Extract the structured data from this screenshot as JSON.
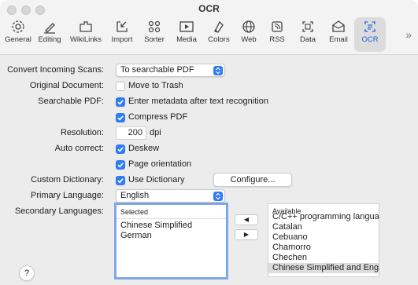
{
  "window": {
    "title": "OCR"
  },
  "toolbar": {
    "items": [
      {
        "label": "General",
        "icon": "gear-icon"
      },
      {
        "label": "Editing",
        "icon": "pen-icon"
      },
      {
        "label": "WikiLinks",
        "icon": "puzzle-icon"
      },
      {
        "label": "Import",
        "icon": "import-icon"
      },
      {
        "label": "Sorter",
        "icon": "sorter-icon"
      },
      {
        "label": "Media",
        "icon": "media-icon"
      },
      {
        "label": "Colors",
        "icon": "colors-icon"
      },
      {
        "label": "Web",
        "icon": "globe-icon"
      },
      {
        "label": "RSS",
        "icon": "rss-icon"
      },
      {
        "label": "Data",
        "icon": "data-icon"
      },
      {
        "label": "Email",
        "icon": "email-icon"
      },
      {
        "label": "OCR",
        "icon": "ocr-icon",
        "active": true
      }
    ],
    "overflow": "»",
    "accent": "#2f7cf6"
  },
  "form": {
    "convert_label": "Convert Incoming Scans:",
    "convert_value": "To searchable PDF",
    "original_label": "Original Document:",
    "move_to_trash": "Move to Trash",
    "searchable_label": "Searchable PDF:",
    "enter_metadata": "Enter metadata after text recognition",
    "compress_pdf": "Compress PDF",
    "resolution_label": "Resolution:",
    "resolution_value": "200",
    "resolution_unit": "dpi",
    "autocorrect_label": "Auto correct:",
    "deskew": "Deskew",
    "page_orientation": "Page orientation",
    "custom_dict_label": "Custom Dictionary:",
    "use_dictionary": "Use Dictionary",
    "configure_button": "Configure...",
    "primary_label": "Primary Language:",
    "primary_value": "English",
    "secondary_label": "Secondary Languages:"
  },
  "selected_list": {
    "header": "Selected",
    "items": [
      "Chinese Simplified",
      "German"
    ]
  },
  "available_list": {
    "header": "Available",
    "items": [
      "C/C++ programming language",
      "Catalan",
      "Cebuano",
      "Chamorro",
      "Chechen",
      "Chinese Simplified and Engli..."
    ]
  },
  "arrows": {
    "left": "◀",
    "right": "▶"
  },
  "help": "?"
}
